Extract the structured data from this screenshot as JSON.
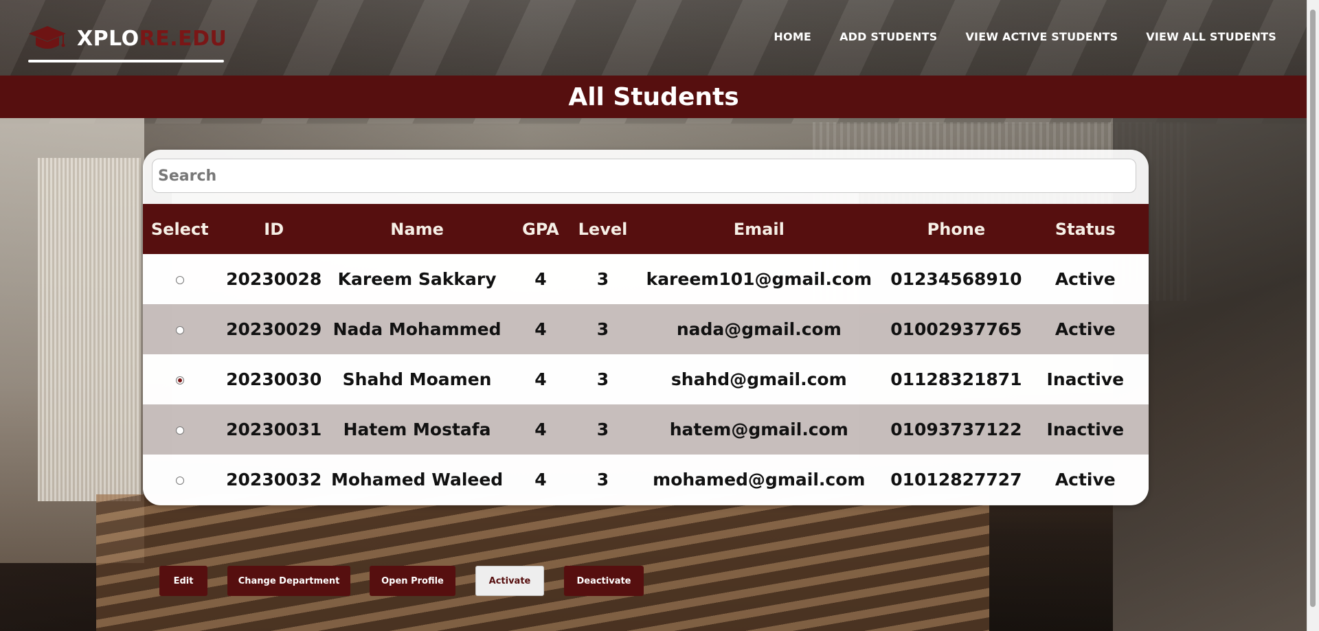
{
  "brand": {
    "logo_part1": "XPLO",
    "logo_part2": "RE.EDU",
    "accent_color": "#560f0f"
  },
  "nav": {
    "items": [
      {
        "label": "HOME"
      },
      {
        "label": "ADD STUDENTS"
      },
      {
        "label": "VIEW ACTIVE STUDENTS"
      },
      {
        "label": "VIEW ALL STUDENTS"
      }
    ]
  },
  "page": {
    "title": "All Students"
  },
  "search": {
    "placeholder": "Search",
    "value": ""
  },
  "table": {
    "columns": [
      "Select",
      "ID",
      "Name",
      "GPA",
      "Level",
      "Email",
      "Phone",
      "Status"
    ],
    "rows": [
      {
        "selected": false,
        "id": "20230028",
        "name": "Kareem Sakkary",
        "gpa": "4",
        "level": "3",
        "email": "kareem101@gmail.com",
        "phone": "01234568910",
        "status": "Active"
      },
      {
        "selected": false,
        "id": "20230029",
        "name": "Nada Mohammed",
        "gpa": "4",
        "level": "3",
        "email": "nada@gmail.com",
        "phone": "01002937765",
        "status": "Active"
      },
      {
        "selected": true,
        "id": "20230030",
        "name": "Shahd Moamen",
        "gpa": "4",
        "level": "3",
        "email": "shahd@gmail.com",
        "phone": "01128321871",
        "status": "Inactive"
      },
      {
        "selected": false,
        "id": "20230031",
        "name": "Hatem Mostafa",
        "gpa": "4",
        "level": "3",
        "email": "hatem@gmail.com",
        "phone": "01093737122",
        "status": "Inactive"
      },
      {
        "selected": false,
        "id": "20230032",
        "name": "Mohamed Waleed",
        "gpa": "4",
        "level": "3",
        "email": "mohamed@gmail.com",
        "phone": "01012827727",
        "status": "Active"
      }
    ]
  },
  "actions": {
    "edit": "Edit",
    "change_department": "Change Department",
    "open_profile": "Open Profile",
    "activate": "Activate",
    "deactivate": "Deactivate"
  }
}
